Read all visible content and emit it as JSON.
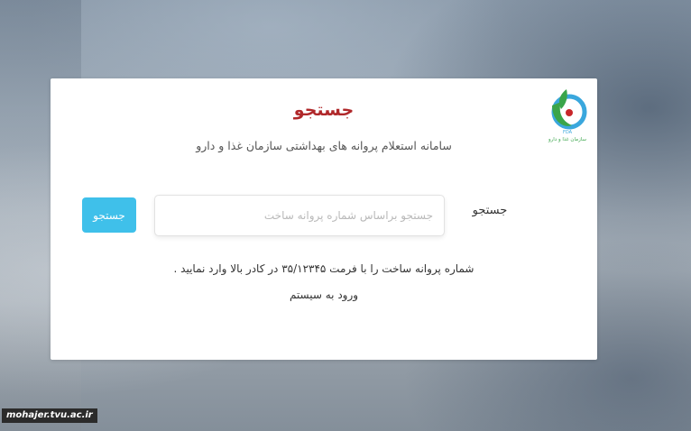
{
  "card": {
    "title": "جستجو",
    "subtitle": "سامانه استعلام پروانه های بهداشتی سازمان غذا و دارو"
  },
  "logo": {
    "icon": "fda-logo-icon",
    "caption": "سازمان غذا و دارو",
    "abbr": "FDA",
    "colors": {
      "green": "#3aa54a",
      "blue": "#3aa7dd",
      "red": "#c8262a"
    }
  },
  "search": {
    "label": "جستجو",
    "placeholder": "جستجو براساس شماره پروانه ساخت",
    "value": "",
    "button_label": "جستجو",
    "button_color": "#3fc0ea"
  },
  "hint": "شماره پروانه ساخت را با فرمت ۳۵/۱۲۳۴۵ در کادر بالا وارد نمایید .",
  "login_link": "ورود به سیستم",
  "footer": {
    "site": "mohajer.tvu.ac.ir"
  }
}
